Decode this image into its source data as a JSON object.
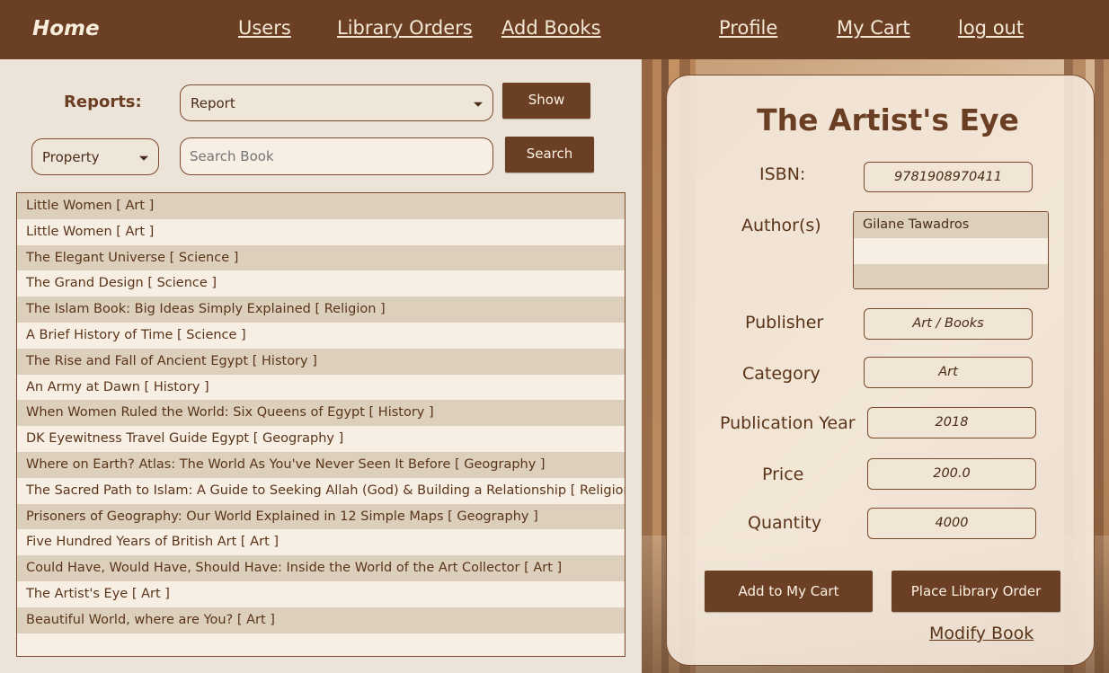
{
  "nav": {
    "home": "Home",
    "users": "Users",
    "library_orders": "Library Orders",
    "add_books": "Add Books",
    "profile": "Profile",
    "my_cart": "My Cart",
    "logout": "log out"
  },
  "reports": {
    "label": "Reports:",
    "select_value": "Report",
    "show_button": "Show"
  },
  "search": {
    "property_value": "Property",
    "placeholder": "Search Book",
    "button": "Search"
  },
  "books": [
    "Little Women [ Art ]",
    "Little Women [ Art ]",
    "The Elegant Universe [ Science ]",
    "The Grand Design [ Science ]",
    "The Islam Book: Big Ideas Simply Explained [ Religion ]",
    "A Brief History of Time [ Science ]",
    "The Rise and Fall of Ancient Egypt [ History ]",
    "An Army at Dawn [ History ]",
    "When Women Ruled the World: Six Queens of Egypt [ History ]",
    "DK Eyewitness Travel Guide Egypt [ Geography ]",
    "Where on Earth? Atlas: The World As You've Never Seen It Before [ Geography ]",
    "The Sacred Path to Islam: A Guide to Seeking Allah (God) & Building a Relationship [ Religion ]",
    "Prisoners of Geography: Our World Explained in 12 Simple Maps [ Geography ]",
    "Five Hundred Years of British Art [ Art ]",
    "Could Have, Would Have, Should Have: Inside the World of the Art Collector [ Art ]",
    "The Artist's Eye [ Art ]",
    "Beautiful World, where are You? [ Art ]"
  ],
  "detail": {
    "title": "The Artist's Eye",
    "isbn_label": "ISBN:",
    "isbn": "9781908970411",
    "authors_label": "Author(s)",
    "authors": [
      "Gilane Tawadros"
    ],
    "publisher_label": "Publisher",
    "publisher": "Art / Books",
    "category_label": "Category",
    "category": "Art",
    "year_label": "Publication Year",
    "year": "2018",
    "price_label": "Price",
    "price": "200.0",
    "quantity_label": "Quantity",
    "quantity": "4000",
    "add_to_cart": "Add to My Cart",
    "place_order": "Place Library Order",
    "modify": "Modify Book"
  },
  "colors": {
    "primary_brown": "#6b3f24",
    "panel_bg": "#ece4d8",
    "row_alt": "#dcd0bd"
  }
}
